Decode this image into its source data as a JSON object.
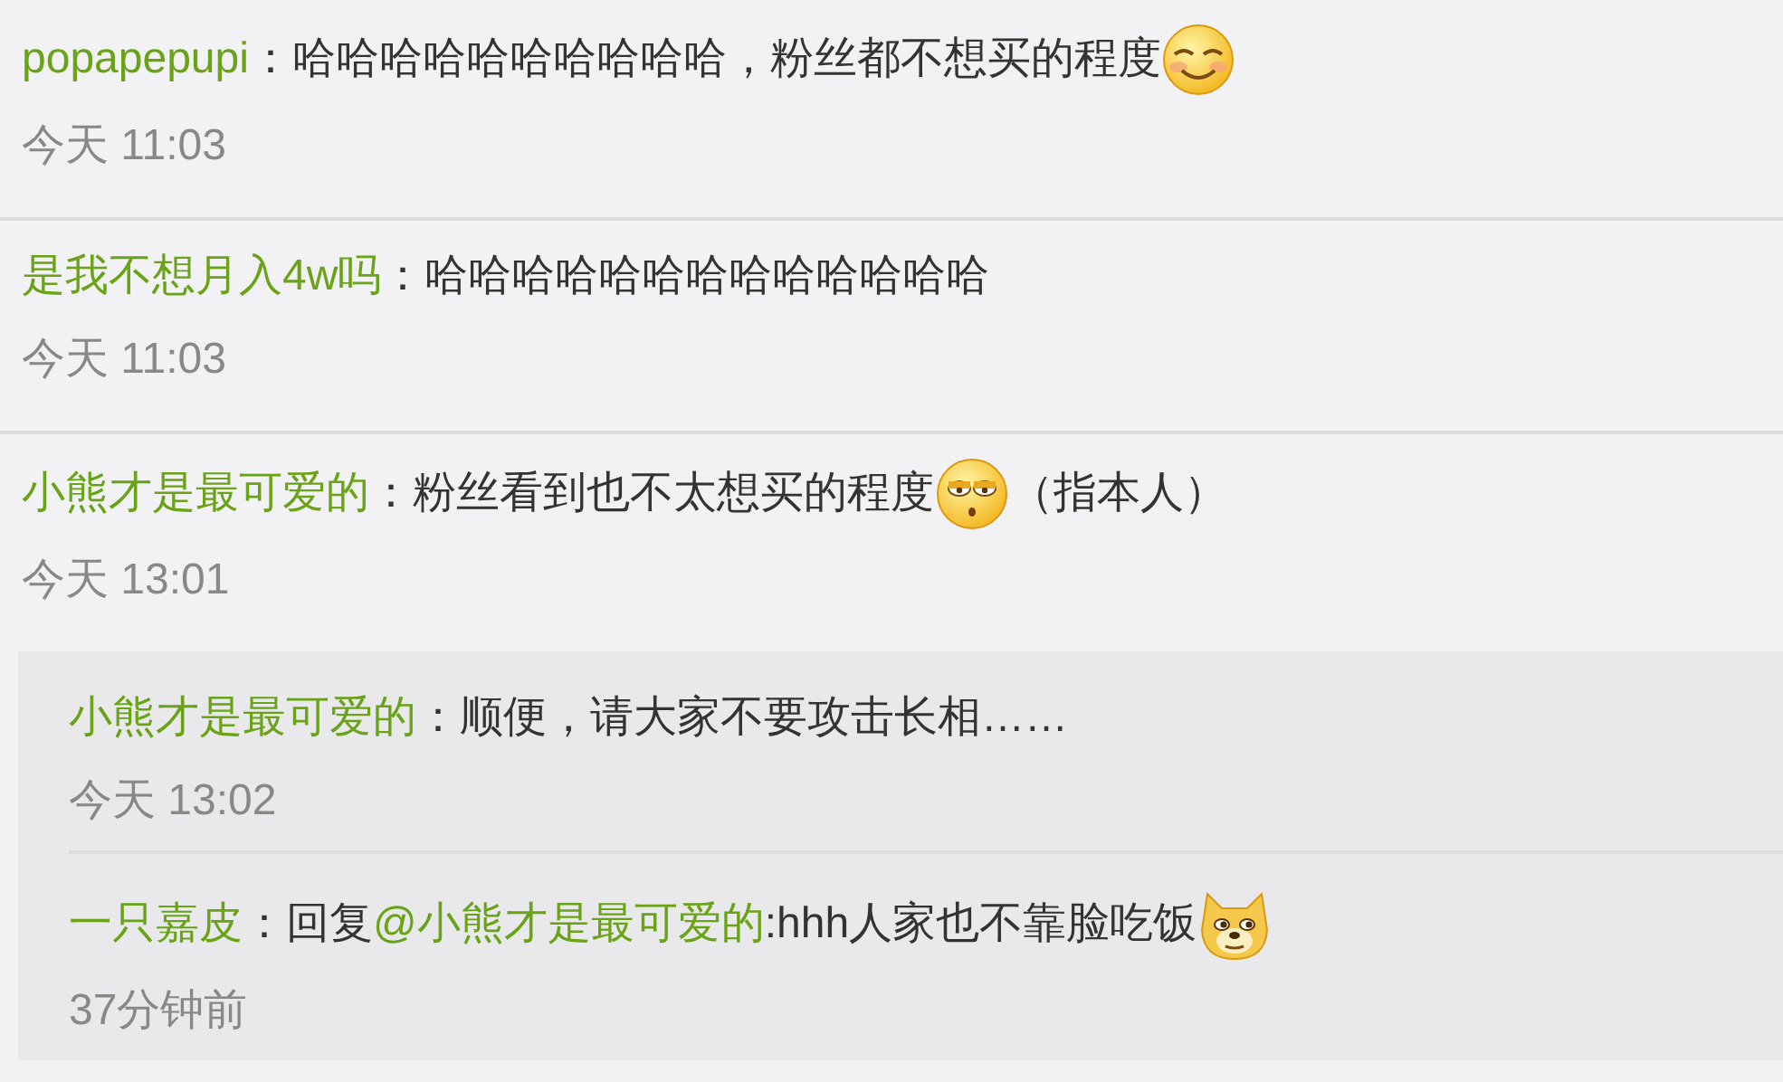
{
  "comments": [
    {
      "user": "popapepupi",
      "text": "：哈哈哈哈哈哈哈哈哈哈，粉丝都不想买的程度",
      "emoji": {
        "kind": "smile"
      },
      "time": "今天 11:03"
    },
    {
      "user": "是我不想月入4w吗",
      "text": "：哈哈哈哈哈哈哈哈哈哈哈哈哈",
      "time": "今天 11:03"
    },
    {
      "user": "小熊才是最可爱的",
      "text": "：粉丝看到也不太想买的程度",
      "emoji": {
        "kind": "sleepy"
      },
      "after_emoji": "（指本人）",
      "time": "今天 13:01",
      "replies": [
        {
          "user": "小熊才是最可爱的",
          "text": "：顺便，请大家不要攻击长相……",
          "time": "今天 13:02"
        },
        {
          "user": "一只嘉皮",
          "text": "：回复",
          "mention": "@小熊才是最可爱的",
          "after_mention": ":hhh人家也不靠脸吃饭",
          "emoji": {
            "kind": "doge"
          },
          "time": "37分钟前"
        }
      ]
    }
  ]
}
